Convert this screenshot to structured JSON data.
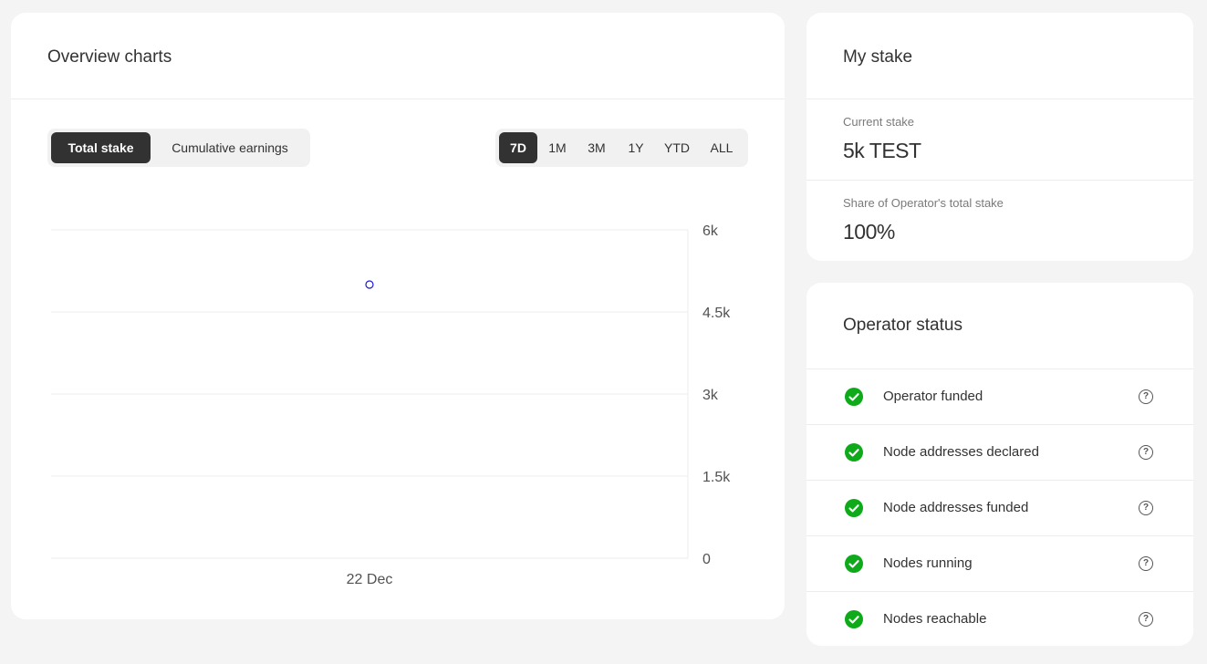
{
  "overview": {
    "title": "Overview charts",
    "chart_tabs": [
      "Total stake",
      "Cumulative earnings"
    ],
    "active_chart_tab": "Total stake",
    "ranges": [
      "7D",
      "1M",
      "3M",
      "1Y",
      "YTD",
      "ALL"
    ],
    "active_range": "7D"
  },
  "chart_data": {
    "type": "scatter",
    "title": "",
    "xlabel": "",
    "ylabel": "",
    "x_tick_labels": [
      "22 Dec"
    ],
    "y_tick_labels": [
      "6k",
      "4.5k",
      "3k",
      "1.5k",
      "0"
    ],
    "ylim": [
      0,
      6000
    ],
    "points": [
      {
        "x": "22 Dec",
        "y": 5000
      }
    ],
    "point_color": "#1a1ad6",
    "grid": true,
    "y_axis_position": "right"
  },
  "my_stake": {
    "title": "My stake",
    "current_stake_label": "Current stake",
    "current_stake_value": "5k TEST",
    "share_label": "Share of Operator's total stake",
    "share_value": "100%"
  },
  "operator_status": {
    "title": "Operator status",
    "items": [
      {
        "label": "Operator funded",
        "status": "ok"
      },
      {
        "label": "Node addresses declared",
        "status": "ok"
      },
      {
        "label": "Node addresses funded",
        "status": "ok"
      },
      {
        "label": "Nodes running",
        "status": "ok"
      },
      {
        "label": "Nodes reachable",
        "status": "ok"
      }
    ],
    "ok_color": "#0eaa1a",
    "help_icon": "question-circle-icon",
    "check_icon": "check-circle-icon"
  }
}
